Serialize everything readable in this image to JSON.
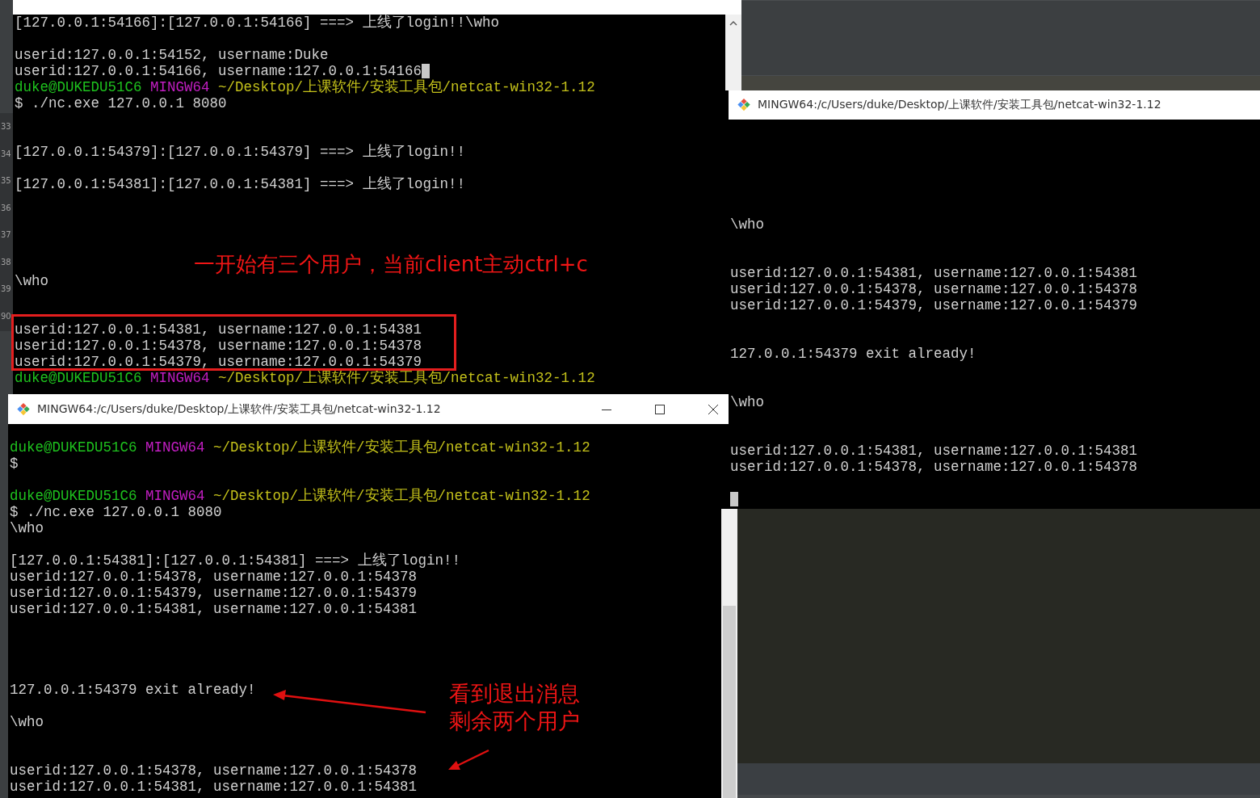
{
  "editor_gutter": {
    "line_numbers": [
      "33",
      "34",
      "35",
      "36",
      "37",
      "38",
      "39",
      "90"
    ]
  },
  "windows": [
    {
      "kind": "back",
      "lines": [
        {
          "kind": "text",
          "text": "[127.0.0.1:54166]:[127.0.0.1:54166] ===> 上线了login!!\\who"
        },
        {
          "kind": "blank"
        },
        {
          "kind": "text",
          "text": "userid:127.0.0.1:54152, username:Duke"
        },
        {
          "kind": "text",
          "text": "userid:127.0.0.1:54166, username:127.0.0.1:54166",
          "cursor": true
        },
        {
          "kind": "prompt",
          "user": "duke@DUKEDU51C6",
          "shell": "MINGW64",
          "path": "~/Desktop/上课软件/安装工具包/netcat-win32-1.12"
        },
        {
          "kind": "text",
          "text": "$ ./nc.exe 127.0.0.1 8080"
        },
        {
          "kind": "blank"
        },
        {
          "kind": "blank"
        },
        {
          "kind": "text",
          "text": "[127.0.0.1:54379]:[127.0.0.1:54379] ===> 上线了login!!"
        },
        {
          "kind": "blank"
        },
        {
          "kind": "text",
          "text": "[127.0.0.1:54381]:[127.0.0.1:54381] ===> 上线了login!!"
        },
        {
          "kind": "blank"
        },
        {
          "kind": "blank"
        },
        {
          "kind": "blank"
        },
        {
          "kind": "blank"
        },
        {
          "kind": "blank"
        },
        {
          "kind": "text",
          "text": "\\who"
        },
        {
          "kind": "blank"
        },
        {
          "kind": "blank"
        },
        {
          "kind": "text",
          "text": "userid:127.0.0.1:54381, username:127.0.0.1:54381"
        },
        {
          "kind": "text",
          "text": "userid:127.0.0.1:54378, username:127.0.0.1:54378"
        },
        {
          "kind": "text",
          "text": "userid:127.0.0.1:54379, username:127.0.0.1:54379"
        },
        {
          "kind": "prompt",
          "user": "duke@DUKEDU51C6",
          "shell": "MINGW64",
          "path": "~/Desktop/上课软件/安装工具包/netcat-win32-1.12"
        }
      ]
    },
    {
      "kind": "right",
      "title": "MINGW64:/c/Users/duke/Desktop/上课软件/安装工具包/netcat-win32-1.12",
      "lines": [
        {
          "kind": "blank"
        },
        {
          "kind": "blank"
        },
        {
          "kind": "blank"
        },
        {
          "kind": "blank"
        },
        {
          "kind": "blank"
        },
        {
          "kind": "blank"
        },
        {
          "kind": "text",
          "text": "\\who"
        },
        {
          "kind": "blank"
        },
        {
          "kind": "blank"
        },
        {
          "kind": "text",
          "text": "userid:127.0.0.1:54381, username:127.0.0.1:54381"
        },
        {
          "kind": "text",
          "text": "userid:127.0.0.1:54378, username:127.0.0.1:54378"
        },
        {
          "kind": "text",
          "text": "userid:127.0.0.1:54379, username:127.0.0.1:54379"
        },
        {
          "kind": "blank"
        },
        {
          "kind": "blank"
        },
        {
          "kind": "text",
          "text": "127.0.0.1:54379 exit already!"
        },
        {
          "kind": "blank"
        },
        {
          "kind": "blank"
        },
        {
          "kind": "text",
          "text": "\\who"
        },
        {
          "kind": "blank"
        },
        {
          "kind": "blank"
        },
        {
          "kind": "text",
          "text": "userid:127.0.0.1:54381, username:127.0.0.1:54381"
        },
        {
          "kind": "text",
          "text": "userid:127.0.0.1:54378, username:127.0.0.1:54378"
        },
        {
          "kind": "blank"
        },
        {
          "kind": "cursor"
        }
      ]
    },
    {
      "kind": "front",
      "title": "MINGW64:/c/Users/duke/Desktop/上课软件/安装工具包/netcat-win32-1.12",
      "lines": [
        {
          "kind": "prompt",
          "user": "duke@DUKEDU51C6",
          "shell": "MINGW64",
          "path": "~/Desktop/上课软件/安装工具包/netcat-win32-1.12"
        },
        {
          "kind": "text",
          "text": "$"
        },
        {
          "kind": "blank"
        },
        {
          "kind": "prompt",
          "user": "duke@DUKEDU51C6",
          "shell": "MINGW64",
          "path": "~/Desktop/上课软件/安装工具包/netcat-win32-1.12"
        },
        {
          "kind": "text",
          "text": "$ ./nc.exe 127.0.0.1 8080"
        },
        {
          "kind": "text",
          "text": "\\who"
        },
        {
          "kind": "blank"
        },
        {
          "kind": "text",
          "text": "[127.0.0.1:54381]:[127.0.0.1:54381] ===> 上线了login!!"
        },
        {
          "kind": "text",
          "text": "userid:127.0.0.1:54378, username:127.0.0.1:54378"
        },
        {
          "kind": "text",
          "text": "userid:127.0.0.1:54379, username:127.0.0.1:54379"
        },
        {
          "kind": "text",
          "text": "userid:127.0.0.1:54381, username:127.0.0.1:54381"
        },
        {
          "kind": "blank"
        },
        {
          "kind": "blank"
        },
        {
          "kind": "blank"
        },
        {
          "kind": "blank"
        },
        {
          "kind": "text",
          "text": "127.0.0.1:54379 exit already!"
        },
        {
          "kind": "blank"
        },
        {
          "kind": "text",
          "text": "\\who"
        },
        {
          "kind": "blank"
        },
        {
          "kind": "blank"
        },
        {
          "kind": "text",
          "text": "userid:127.0.0.1:54378, username:127.0.0.1:54378"
        },
        {
          "kind": "text",
          "text": "userid:127.0.0.1:54381, username:127.0.0.1:54381"
        }
      ]
    }
  ],
  "annotations": [
    {
      "kind": "note",
      "lines": [
        "一开始有三个用户，当前client主动ctrl+c"
      ]
    },
    {
      "kind": "note",
      "lines": [
        "看到退出消息",
        "剩余两个用户"
      ]
    }
  ]
}
